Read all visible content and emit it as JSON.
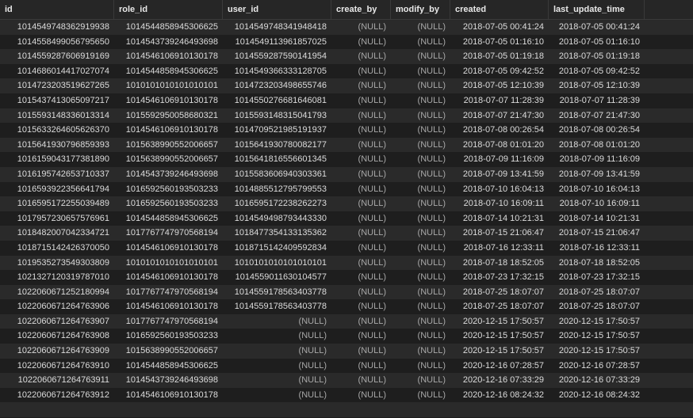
{
  "columns": [
    "id",
    "role_id",
    "user_id",
    "create_by",
    "modify_by",
    "created",
    "last_update_time"
  ],
  "rows": [
    [
      "1014549748362919938",
      "1014544858945306625",
      "1014549748341948418",
      "(NULL)",
      "(NULL)",
      "2018-07-05 00:41:24",
      "2018-07-05 00:41:24"
    ],
    [
      "1014558499056795650",
      "1014543739246493698",
      "1014549113961857025",
      "(NULL)",
      "(NULL)",
      "2018-07-05 01:16:10",
      "2018-07-05 01:16:10"
    ],
    [
      "1014559287606919169",
      "101454610691013017​8",
      "1014559287590141954",
      "(NULL)",
      "(NULL)",
      "2018-07-05 01:19:18",
      "2018-07-05 01:19:18"
    ],
    [
      "1014686014417027074",
      "1014544858945306625",
      "1014549366333128705",
      "(NULL)",
      "(NULL)",
      "2018-07-05 09:42:52",
      "2018-07-05 09:42:52"
    ],
    [
      "1014723203519627265",
      "1010101010101010101",
      "1014723203498655746",
      "(NULL)",
      "(NULL)",
      "2018-07-05 12:10:39",
      "2018-07-05 12:10:39"
    ],
    [
      "1015437413065097217",
      "1014546106910130178",
      "1014550276681646081",
      "(NULL)",
      "(NULL)",
      "2018-07-07 11:28:39",
      "2018-07-07 11:28:39"
    ],
    [
      "1015593148336013314",
      "1015592950058680321",
      "1015593148315041793",
      "(NULL)",
      "(NULL)",
      "2018-07-07 21:47:30",
      "2018-07-07 21:47:30"
    ],
    [
      "1015633264605626370",
      "1014546106910130178",
      "1014709521985191937",
      "(NULL)",
      "(NULL)",
      "2018-07-08 00:26:54",
      "2018-07-08 00:26:54"
    ],
    [
      "1015641930796859393",
      "1015638990552006657",
      "1015641930780082177",
      "(NULL)",
      "(NULL)",
      "2018-07-08 01:01:20",
      "2018-07-08 01:01:20"
    ],
    [
      "1016159043177381890",
      "1015638990552006657",
      "1015641816556601345",
      "(NULL)",
      "(NULL)",
      "2018-07-09 11:16:09",
      "2018-07-09 11:16:09"
    ],
    [
      "1016195742653710337",
      "1014543739246493698",
      "1015583606940303361",
      "(NULL)",
      "(NULL)",
      "2018-07-09 13:41:59",
      "2018-07-09 13:41:59"
    ],
    [
      "1016593922356641794",
      "1016592560193503233",
      "1014885512795799553",
      "(NULL)",
      "(NULL)",
      "2018-07-10 16:04:13",
      "2018-07-10 16:04:13"
    ],
    [
      "1016595172255039489",
      "1016592560193503233",
      "1016595172238262273",
      "(NULL)",
      "(NULL)",
      "2018-07-10 16:09:11",
      "2018-07-10 16:09:11"
    ],
    [
      "1017957230657576961",
      "1014544858945306625",
      "1014549498793443330",
      "(NULL)",
      "(NULL)",
      "2018-07-14 10:21:31",
      "2018-07-14 10:21:31"
    ],
    [
      "1018482007042334721",
      "1017767747970568194",
      "1018477354133135362",
      "(NULL)",
      "(NULL)",
      "2018-07-15 21:06:47",
      "2018-07-15 21:06:47"
    ],
    [
      "1018715142426370050",
      "1014546106910130178",
      "1018715142409592834",
      "(NULL)",
      "(NULL)",
      "2018-07-16 12:33:11",
      "2018-07-16 12:33:11"
    ],
    [
      "1019535273549303809",
      "1010101010101010101",
      "1010101010101010101",
      "(NULL)",
      "(NULL)",
      "2018-07-18 18:52:05",
      "2018-07-18 18:52:05"
    ],
    [
      "1021327120319787010",
      "1014546106910130178",
      "1014559011630104577",
      "(NULL)",
      "(NULL)",
      "2018-07-23 17:32:15",
      "2018-07-23 17:32:15"
    ],
    [
      "1022060671252180994",
      "1017767747970568194",
      "1014559178563403778",
      "(NULL)",
      "(NULL)",
      "2018-07-25 18:07:07",
      "2018-07-25 18:07:07"
    ],
    [
      "1022060671264763906",
      "1014546106910130178",
      "1014559178563403778",
      "(NULL)",
      "(NULL)",
      "2018-07-25 18:07:07",
      "2018-07-25 18:07:07"
    ],
    [
      "1022060671264763907",
      "1017767747970568194",
      "(NULL)",
      "(NULL)",
      "(NULL)",
      "2020-12-15 17:50:57",
      "2020-12-15 17:50:57"
    ],
    [
      "1022060671264763908",
      "1016592560193503233",
      "(NULL)",
      "(NULL)",
      "(NULL)",
      "2020-12-15 17:50:57",
      "2020-12-15 17:50:57"
    ],
    [
      "1022060671264763909",
      "1015638990552006657",
      "(NULL)",
      "(NULL)",
      "(NULL)",
      "2020-12-15 17:50:57",
      "2020-12-15 17:50:57"
    ],
    [
      "1022060671264763910",
      "1014544858945306625",
      "(NULL)",
      "(NULL)",
      "(NULL)",
      "2020-12-16 07:28:57",
      "2020-12-16 07:28:57"
    ],
    [
      "1022060671264763911",
      "1014543739246493698",
      "(NULL)",
      "(NULL)",
      "(NULL)",
      "2020-12-16 07:33:29",
      "2020-12-16 07:33:29"
    ],
    [
      "1022060671264763912",
      "1014546106910130178",
      "(NULL)",
      "(NULL)",
      "(NULL)",
      "2020-12-16 08:24:32",
      "2020-12-16 08:24:32"
    ],
    [
      "",
      "",
      "",
      "",
      "",
      "",
      ""
    ]
  ]
}
